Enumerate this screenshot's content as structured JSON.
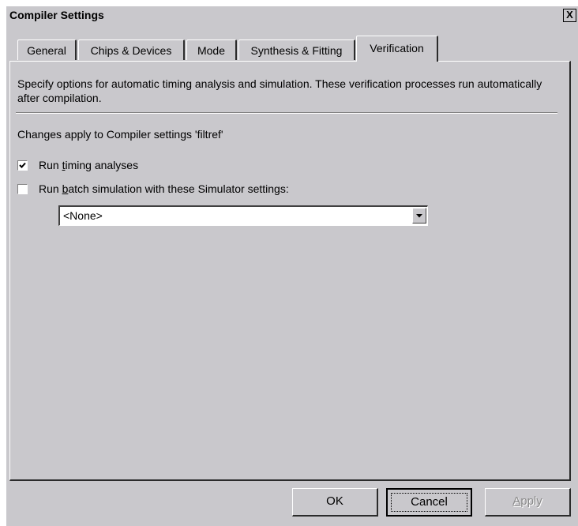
{
  "window": {
    "title": "Compiler Settings",
    "close_label": "X"
  },
  "tabs": [
    {
      "label": "General"
    },
    {
      "label": "Chips & Devices"
    },
    {
      "label": "Mode"
    },
    {
      "label": "Synthesis & Fitting"
    },
    {
      "label": "Verification",
      "active": true
    }
  ],
  "panel": {
    "description": "Specify options for automatic timing analysis and simulation.  These verification processes run automatically after compilation.",
    "changes_text": "Changes apply to Compiler settings 'filtref'",
    "timing_checkbox": {
      "label_pre": "Run ",
      "label_accel": "t",
      "label_post": "iming analyses",
      "checked": true
    },
    "simulation_checkbox": {
      "label_pre": "Run ",
      "label_accel": "b",
      "label_post": "atch simulation with these Simulator settings:",
      "checked": false
    },
    "simulator_select": {
      "value": "<None>"
    }
  },
  "buttons": {
    "ok": "OK",
    "cancel": "Cancel",
    "apply_accel": "A",
    "apply_rest": "pply"
  }
}
